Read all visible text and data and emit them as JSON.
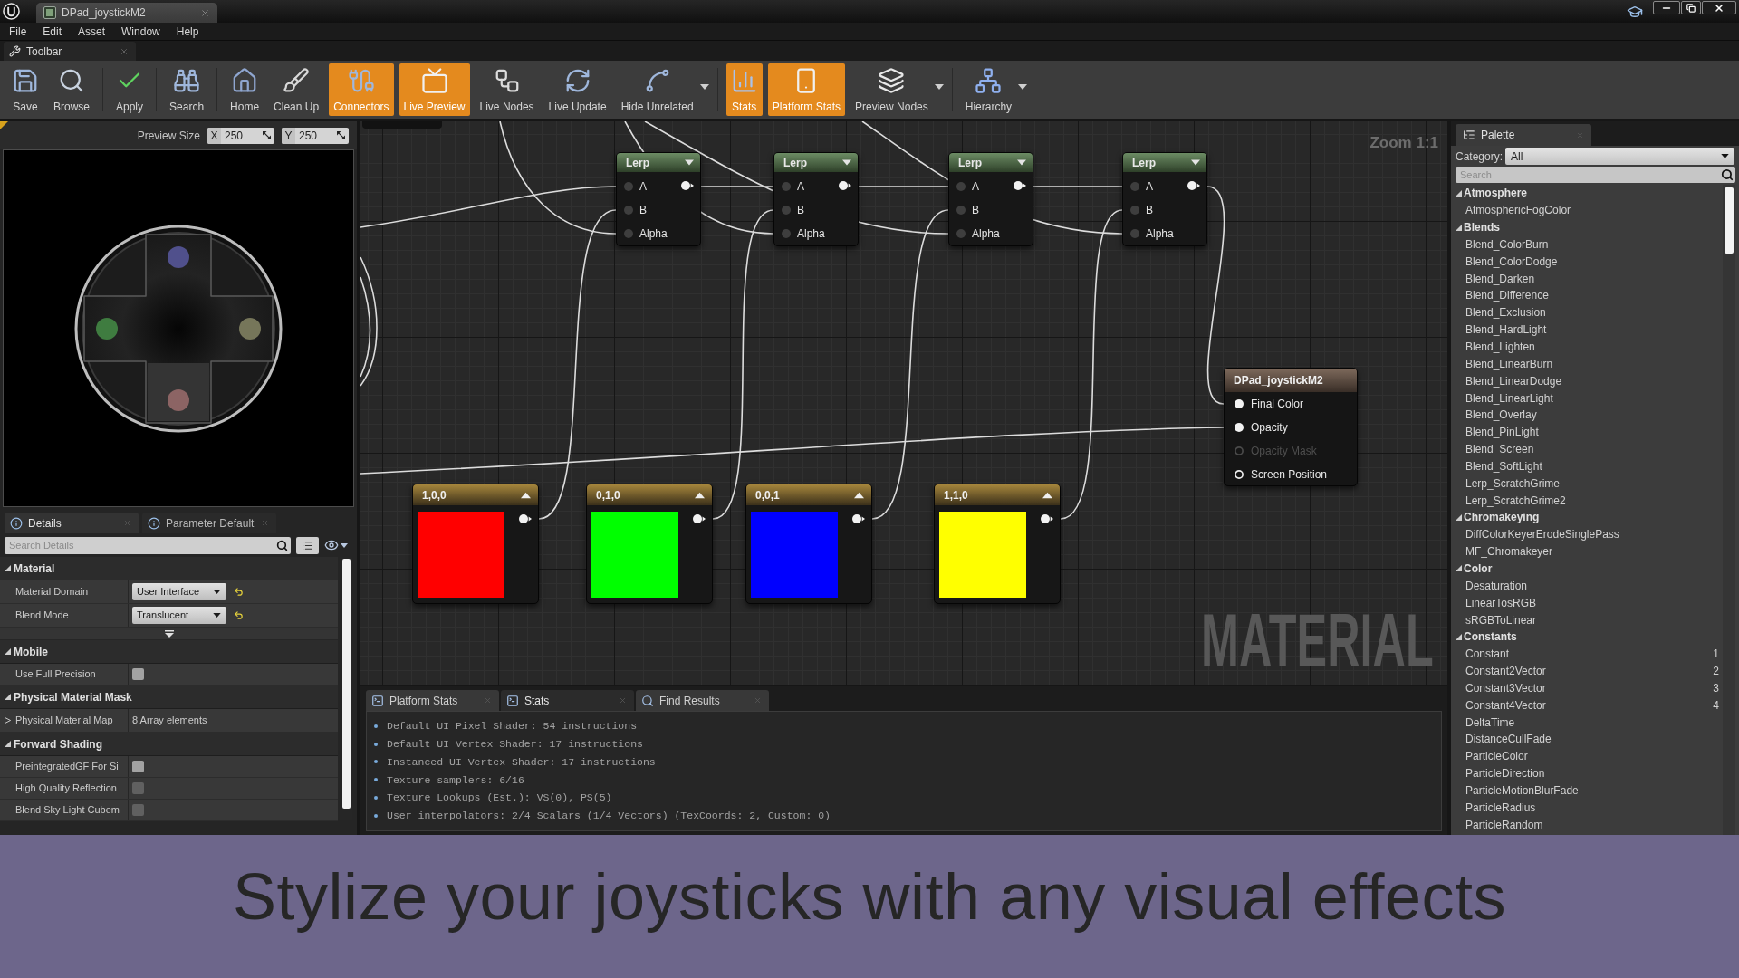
{
  "title_bar": {
    "tab": "DPad_joystickM2"
  },
  "menu": [
    "File",
    "Edit",
    "Asset",
    "Window",
    "Help"
  ],
  "toolbar_tab": {
    "label": "Toolbar"
  },
  "toolbar": {
    "groups": [
      {
        "buttons": [
          {
            "label": "Save",
            "on": false,
            "menu": false
          },
          {
            "label": "Browse",
            "on": false,
            "menu": false
          }
        ]
      },
      {
        "buttons": [
          {
            "label": "Apply",
            "on": false,
            "menu": false
          }
        ]
      },
      {
        "buttons": [
          {
            "label": "Search",
            "on": false,
            "menu": false
          }
        ]
      },
      {
        "buttons": [
          {
            "label": "Home",
            "on": false,
            "menu": false
          },
          {
            "label": "Clean Up",
            "on": false,
            "menu": false
          },
          {
            "label": "Connectors",
            "on": true,
            "menu": false
          },
          {
            "label": "Live Preview",
            "on": true,
            "menu": false
          },
          {
            "label": "Live Nodes",
            "on": false,
            "menu": false
          },
          {
            "label": "Live Update",
            "on": false,
            "menu": false
          },
          {
            "label": "Hide Unrelated",
            "on": false,
            "menu": true
          }
        ]
      },
      {
        "buttons": [
          {
            "label": "Stats",
            "on": true,
            "menu": false
          },
          {
            "label": "Platform Stats",
            "on": true,
            "menu": false
          },
          {
            "label": "Preview Nodes",
            "on": false,
            "menu": true
          }
        ]
      },
      {
        "buttons": [
          {
            "label": "Hierarchy",
            "on": false,
            "menu": true
          }
        ]
      }
    ]
  },
  "preview": {
    "label": "Preview Size",
    "x": {
      "axis": "X",
      "value": "250"
    },
    "y": {
      "axis": "Y",
      "value": "250"
    }
  },
  "details": {
    "tabs": [
      {
        "label": "Details",
        "selected": true
      },
      {
        "label": "Parameter Default",
        "selected": false
      }
    ],
    "search": {
      "placeholder": "Search Details"
    },
    "sections": [
      {
        "title": "Material",
        "expanded": true,
        "advanced": true,
        "rows": [
          {
            "kind": "dropdown",
            "label": "Material Domain",
            "value": "User Interface",
            "modified": true
          },
          {
            "kind": "dropdown",
            "label": "Blend Mode",
            "value": "Translucent",
            "modified": true
          }
        ]
      },
      {
        "title": "Mobile",
        "expanded": true,
        "advanced": false,
        "rows": [
          {
            "kind": "checkbox",
            "label": "Use Full Precision",
            "checked": false,
            "disabled": false
          }
        ]
      },
      {
        "title": "Physical Material Mask",
        "expanded": true,
        "advanced": false,
        "rows": [
          {
            "kind": "array",
            "label": "Physical Material Map",
            "value": "8 Array elements",
            "expanded": false
          }
        ]
      },
      {
        "title": "Forward Shading",
        "expanded": true,
        "advanced": false,
        "rows": [
          {
            "kind": "checkbox",
            "label": "PreintegratedGF For Si",
            "checked": false,
            "disabled": false
          },
          {
            "kind": "checkbox",
            "label": "High Quality Reflection",
            "checked": false,
            "disabled": true
          },
          {
            "kind": "checkbox",
            "label": "Blend Sky Light Cubem",
            "checked": false,
            "disabled": true
          }
        ]
      }
    ]
  },
  "graph": {
    "zoom_label": "Zoom 1:1",
    "watermark": "MATERIAL",
    "nodes": [
      {
        "kind": "lerp",
        "title": "Lerp",
        "inputs": [
          "A",
          "B",
          "Alpha"
        ]
      },
      {
        "kind": "lerp",
        "title": "Lerp",
        "inputs": [
          "A",
          "B",
          "Alpha"
        ]
      },
      {
        "kind": "lerp",
        "title": "Lerp",
        "inputs": [
          "A",
          "B",
          "Alpha"
        ]
      },
      {
        "kind": "lerp",
        "title": "Lerp",
        "inputs": [
          "A",
          "B",
          "Alpha"
        ]
      },
      {
        "kind": "output",
        "title": "DPad_joystickM2",
        "pins": [
          {
            "label": "Final Color",
            "connected": true,
            "disabled": false
          },
          {
            "label": "Opacity",
            "connected": true,
            "disabled": false
          },
          {
            "label": "Opacity Mask",
            "connected": false,
            "disabled": true
          },
          {
            "label": "Screen Position",
            "connected": false,
            "disabled": false
          }
        ]
      },
      {
        "kind": "color",
        "title": "1,0,0",
        "color": "#ff0000"
      },
      {
        "kind": "color",
        "title": "0,1,0",
        "color": "#00ff00"
      },
      {
        "kind": "color",
        "title": "0,0,1",
        "color": "#0000ff"
      },
      {
        "kind": "color",
        "title": "1,1,0",
        "color": "#ffff00"
      }
    ]
  },
  "stats": {
    "tabs": [
      {
        "label": "Platform Stats",
        "selected": false
      },
      {
        "label": "Stats",
        "selected": true
      },
      {
        "label": "Find Results",
        "selected": false
      }
    ],
    "lines": [
      "Default UI Pixel Shader: 54 instructions",
      "Default UI Vertex Shader: 17 instructions",
      "Instanced UI Vertex Shader: 17 instructions",
      "Texture samplers: 6/16",
      "Texture Lookups (Est.): VS(0), PS(5)",
      "User interpolators: 2/4 Scalars (1/4 Vectors) (TexCoords: 2, Custom: 0)"
    ]
  },
  "palette": {
    "tab": "Palette",
    "category_label": "Category:",
    "category": "All",
    "search": {
      "placeholder": "Search"
    },
    "groups": [
      {
        "label": "Atmosphere",
        "expanded": true,
        "children": [
          {
            "label": "AtmosphericFogColor"
          }
        ]
      },
      {
        "label": "Blends",
        "expanded": true,
        "children": [
          {
            "label": "Blend_ColorBurn"
          },
          {
            "label": "Blend_ColorDodge"
          },
          {
            "label": "Blend_Darken"
          },
          {
            "label": "Blend_Difference"
          },
          {
            "label": "Blend_Exclusion"
          },
          {
            "label": "Blend_HardLight"
          },
          {
            "label": "Blend_Lighten"
          },
          {
            "label": "Blend_LinearBurn"
          },
          {
            "label": "Blend_LinearDodge"
          },
          {
            "label": "Blend_LinearLight"
          },
          {
            "label": "Blend_Overlay"
          },
          {
            "label": "Blend_PinLight"
          },
          {
            "label": "Blend_Screen"
          },
          {
            "label": "Blend_SoftLight"
          },
          {
            "label": "Lerp_ScratchGrime"
          },
          {
            "label": "Lerp_ScratchGrime2"
          }
        ]
      },
      {
        "label": "Chromakeying",
        "expanded": true,
        "children": [
          {
            "label": "DiffColorKeyerErodeSinglePass"
          },
          {
            "label": "MF_Chromakeyer"
          }
        ]
      },
      {
        "label": "Color",
        "expanded": true,
        "children": [
          {
            "label": "Desaturation"
          },
          {
            "label": "LinearTosRGB"
          },
          {
            "label": "sRGBToLinear"
          }
        ]
      },
      {
        "label": "Constants",
        "expanded": true,
        "children": [
          {
            "label": "Constant",
            "hotkey": "1"
          },
          {
            "label": "Constant2Vector",
            "hotkey": "2"
          },
          {
            "label": "Constant3Vector",
            "hotkey": "3"
          },
          {
            "label": "Constant4Vector",
            "hotkey": "4"
          },
          {
            "label": "DeltaTime"
          },
          {
            "label": "DistanceCullFade"
          },
          {
            "label": "ParticleColor"
          },
          {
            "label": "ParticleDirection"
          },
          {
            "label": "ParticleMotionBlurFade"
          },
          {
            "label": "ParticleRadius"
          },
          {
            "label": "ParticleRandom"
          }
        ]
      }
    ]
  },
  "caption": "Stylize your joysticks with any visual effects"
}
